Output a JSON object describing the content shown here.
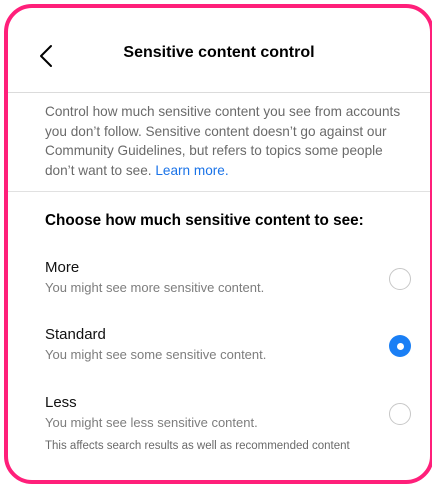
{
  "header": {
    "title": "Sensitive content control",
    "back_icon": "chevron-left-icon"
  },
  "description": {
    "text": "Control how much sensitive content you see from accounts you don’t follow. Sensitive content doesn’t go against our Community Guidelines, but refers to topics some people don’t want to see. ",
    "link": "Learn more."
  },
  "section": {
    "title": "Choose how much sensitive content to see:"
  },
  "options": [
    {
      "label": "More",
      "sublabel": "You might see more sensitive content.",
      "selected": false
    },
    {
      "label": "Standard",
      "sublabel": "You might see some sensitive content.",
      "selected": true
    },
    {
      "label": "Less",
      "sublabel": "You might see less sensitive content.",
      "selected": false
    }
  ],
  "footer": {
    "text": "This affects search results as well as recommended content"
  },
  "colors": {
    "frame_border": "#ff1f7a",
    "accent": "#1a7ff5",
    "link": "#1a73e8"
  }
}
